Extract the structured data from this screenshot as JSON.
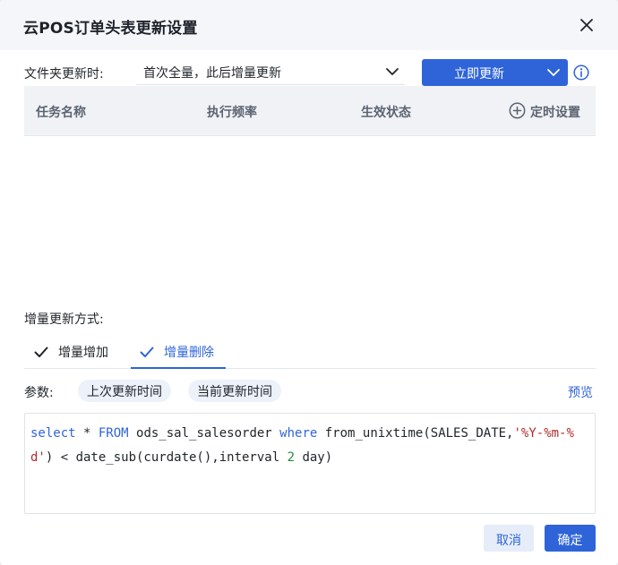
{
  "dialog": {
    "title": "云POS订单头表更新设置"
  },
  "folder_update": {
    "label": "文件夹更新时:",
    "selected_value": "首次全量，此后增量更新"
  },
  "update_button": {
    "label": "立即更新"
  },
  "table": {
    "columns": [
      "任务名称",
      "执行频率",
      "生效状态"
    ],
    "schedule_label": "定时设置",
    "rows": []
  },
  "incremental": {
    "label": "增量更新方式:",
    "tabs": [
      {
        "label": "增量增加",
        "active": false
      },
      {
        "label": "增量删除",
        "active": true
      }
    ]
  },
  "params": {
    "label": "参数:",
    "chips": [
      "上次更新时间",
      "当前更新时间"
    ],
    "preview_label": "预览"
  },
  "sql": {
    "segments": [
      {
        "text": "select",
        "type": "kw"
      },
      {
        "text": " * ",
        "type": "plain"
      },
      {
        "text": "FROM",
        "type": "kw"
      },
      {
        "text": " ods_sal_salesorder ",
        "type": "plain"
      },
      {
        "text": "where",
        "type": "kw"
      },
      {
        "text": " from_unixtime(SALES_DATE,",
        "type": "plain"
      },
      {
        "text": "'%Y-%m-%d'",
        "type": "str"
      },
      {
        "text": ") < date_sub(curdate(),interval ",
        "type": "plain"
      },
      {
        "text": "2",
        "type": "num"
      },
      {
        "text": " day)",
        "type": "plain"
      }
    ]
  },
  "footer": {
    "cancel_label": "取消",
    "confirm_label": "确定"
  },
  "colors": {
    "primary": "#2f64d8",
    "header_bg": "#f4f6fa",
    "table_head_bg": "#f0f2f6",
    "keyword": "#2f64d8",
    "string": "#b22a2a",
    "number": "#2c8a3b"
  }
}
